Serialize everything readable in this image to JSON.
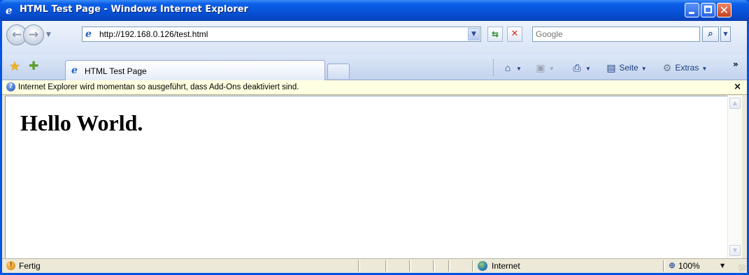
{
  "window": {
    "title": "HTML Test Page - Windows Internet Explorer",
    "title_icon": "ie-icon"
  },
  "navigation": {
    "address": "http://192.168.0.126/test.html",
    "search_placeholder": "Google"
  },
  "tabs": [
    {
      "label": "HTML Test Page",
      "active": true
    }
  ],
  "command_bar": {
    "items": [
      {
        "name": "home",
        "label": "",
        "icon": "home-icon"
      },
      {
        "name": "feeds",
        "label": "",
        "icon": "feeds-icon"
      },
      {
        "name": "print",
        "label": "",
        "icon": "print-icon"
      },
      {
        "name": "page",
        "label": "Seite",
        "icon": "page-icon"
      },
      {
        "name": "tools",
        "label": "Extras",
        "icon": "gear-icon"
      }
    ]
  },
  "info_bar": {
    "text": "Internet Explorer wird momentan so ausgeführt, dass Add-Ons deaktiviert sind.",
    "close": "×"
  },
  "page": {
    "heading": "Hello World."
  },
  "status_bar": {
    "status": "Fertig",
    "zone": "Internet",
    "zoom": "100%"
  },
  "colors": {
    "titlebar": "#0853d8",
    "infobar": "#ffffe1",
    "frame": "#ece9d8"
  }
}
